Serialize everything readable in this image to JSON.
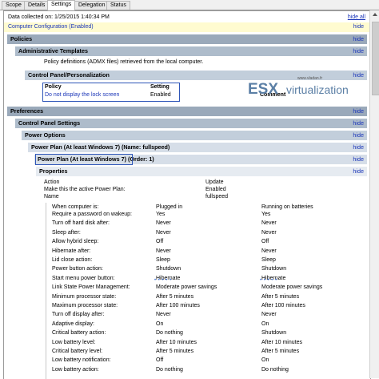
{
  "tabs": [
    "Scope",
    "Details",
    "Settings",
    "Delegation",
    "Status"
  ],
  "active_tab": "Settings",
  "collected": "Data collected on: 1/25/2015 1:40:34 PM",
  "hide_all": "hide all",
  "hide": "hide",
  "computer_config": "Computer Configuration (Enabled)",
  "policies": "Policies",
  "admin_templates": "Administrative Templates",
  "policy_defs": "Policy definitions (ADMX files) retrieved from the local computer.",
  "cp_personalization": "Control Panel/Personalization",
  "policy_table": {
    "headers": [
      "Policy",
      "Setting",
      "Comment"
    ],
    "row": [
      "Do not display the lock screen",
      "Enabled"
    ]
  },
  "watermark": {
    "text1": "ESX",
    "text2": "virtualization",
    "url": "www.vladan.fr"
  },
  "preferences": "Preferences",
  "cp_settings": "Control Panel Settings",
  "power_options": "Power Options",
  "power_plan_name": "Power Plan (At least Windows 7) (Name: fullspeed)",
  "power_plan_order": "Power Plan (At least Windows 7) (Order: 1)",
  "properties": "Properties",
  "props": [
    [
      "Action",
      "Update"
    ],
    [
      "Make this the active Power Plan:",
      "Enabled"
    ],
    [
      "Name",
      "fullspeed"
    ]
  ],
  "settings_headers": [
    "When computer is:",
    "Plugged in",
    "Running on batteries"
  ],
  "settings_rows": [
    [
      "Require a password on wakeup:",
      "Yes",
      "Yes"
    ],
    [
      "Turn off hard disk after:",
      "Never",
      "Never"
    ],
    [
      "Sleep after:",
      "Never",
      "Never"
    ],
    [
      "Allow hybrid sleep:",
      "Off",
      "Off"
    ],
    [
      "Hibernate after:",
      "Never",
      "Never"
    ],
    [
      "Lid close action:",
      "Sleep",
      "Sleep"
    ],
    [
      "Power button action:",
      "Shutdown",
      "Shutdown"
    ],
    [
      "Start menu power button:",
      "Hibernate",
      "Hibernate"
    ],
    [
      "Link State Power Management:",
      "Moderate power savings",
      "Moderate power savings"
    ],
    [
      "Minimum processor state:",
      "After 5 minutes",
      "After 5 minutes"
    ],
    [
      "Maximum processor state:",
      "After 100 minutes",
      "After 100 minutes"
    ],
    [
      "Turn off display after:",
      "Never",
      "Never"
    ],
    [
      "Adaptive display:",
      "On",
      "On"
    ],
    [
      "Critical battery action:",
      "Do nothing",
      "Shutdown"
    ],
    [
      "Low battery level:",
      "After 10 minutes",
      "After 10 minutes"
    ],
    [
      "Critical battery level:",
      "After 5 minutes",
      "After 5 minutes"
    ],
    [
      "Low battery notification:",
      "Off",
      "On"
    ],
    [
      "Low battery action:",
      "Do nothing",
      "Do nothing"
    ]
  ]
}
